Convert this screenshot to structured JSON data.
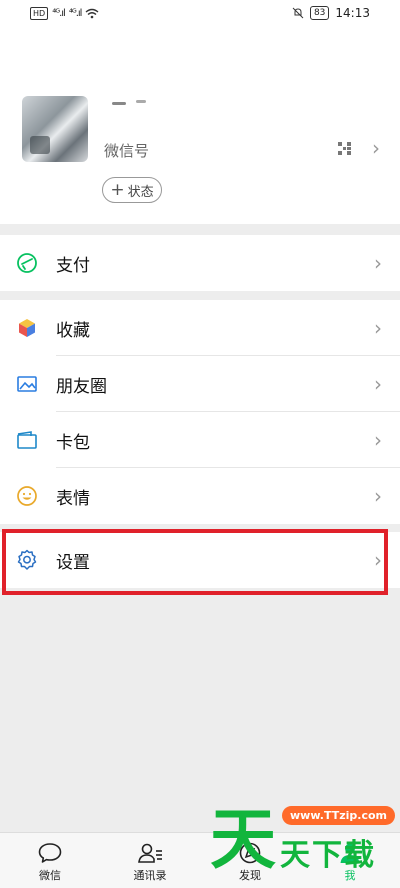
{
  "statusbar": {
    "left_chip": "HD",
    "signal1": "⁴ᴳ.ıl",
    "signal2": "⁴ᴳ.ıl",
    "battery": "83",
    "time": "14:13"
  },
  "profile": {
    "wechat_id_label": "微信号",
    "status_button": "状态"
  },
  "menu": {
    "pay": "支付",
    "favorites": "收藏",
    "moments": "朋友圈",
    "cards": "卡包",
    "stickers": "表情",
    "settings": "设置"
  },
  "tabs": [
    {
      "label": "微信"
    },
    {
      "label": "通讯录"
    },
    {
      "label": "发现"
    },
    {
      "label": "我"
    }
  ],
  "watermark": {
    "url": "www.TTzip.com",
    "big_char": "天",
    "text": "天下载"
  },
  "colors": {
    "accent": "#07c160",
    "highlight": "#e0212a"
  }
}
